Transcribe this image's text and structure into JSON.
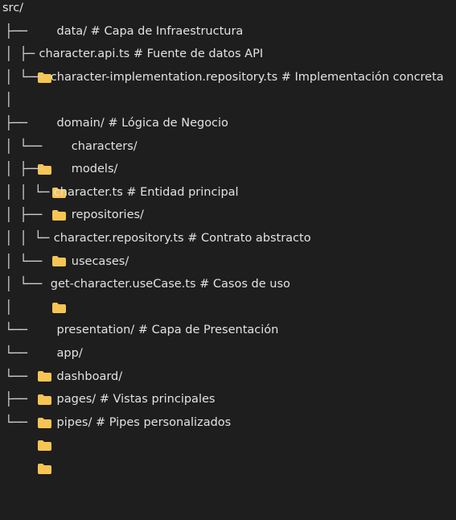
{
  "tree": {
    "lines": [
      {
        "prefix": "",
        "folder": false,
        "text": "src/"
      },
      {
        "prefix": "├── ",
        "folder": true,
        "text": "data/ # Capa de Infraestructura"
      },
      {
        "prefix": "│ ├─",
        "folder": false,
        "text": "character.api.ts # Fuente de datos API"
      },
      {
        "prefix": "│ └── ",
        "folder": false,
        "text": "character-implementation.repository.ts # Implementación concreta"
      },
      {
        "prefix": "│",
        "folder": false,
        "text": ""
      },
      {
        "prefix": "├── ",
        "folder": true,
        "text": "domain/ # Lógica de Negocio"
      },
      {
        "prefix": "│ └── ",
        "folder": true,
        "text": "characters/"
      },
      {
        "prefix": "│ ├── ",
        "folder": true,
        "text": "models/"
      },
      {
        "prefix": "│ │ └─",
        "folder": false,
        "text": "character.ts # Entidad principal"
      },
      {
        "prefix": "│ ├── ",
        "folder": true,
        "text": "repositories/"
      },
      {
        "prefix": "│ │ └─",
        "folder": false,
        "text": "character.repository.ts # Contrato abstracto"
      },
      {
        "prefix": "│ └── ",
        "folder": true,
        "text": "usecases/"
      },
      {
        "prefix": "│ └── ",
        "folder": false,
        "text": "get-character.useCase.ts # Casos de uso"
      },
      {
        "prefix": "│",
        "folder": false,
        "text": ""
      },
      {
        "prefix": "└── ",
        "folder": true,
        "text": "presentation/ # Capa de Presentación"
      },
      {
        "prefix": "└── ",
        "folder": true,
        "text": "app/"
      },
      {
        "prefix": "└── ",
        "folder": true,
        "text": "dashboard/"
      },
      {
        "prefix": "├── ",
        "folder": true,
        "text": "pages/ # Vistas principales"
      },
      {
        "prefix": "└── ",
        "folder": true,
        "text": "pipes/ # Pipes personalizados"
      }
    ]
  },
  "colors": {
    "background": "#1e1e1e",
    "text": "#e2e2e2",
    "folder": "#f7c553"
  },
  "icons": {
    "folder": "folder-icon"
  }
}
